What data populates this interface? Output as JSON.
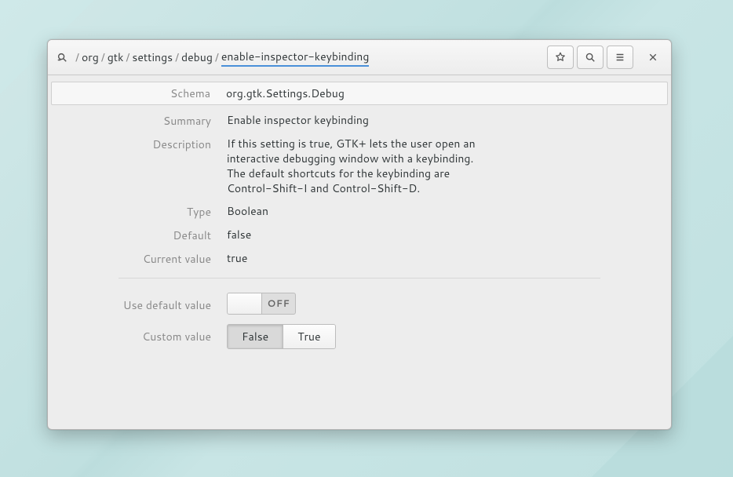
{
  "breadcrumb": {
    "segments": [
      "org",
      "gtk",
      "settings",
      "debug"
    ],
    "current": "enable-inspector-keybinding"
  },
  "labels": {
    "schema": "Schema",
    "summary": "Summary",
    "description": "Description",
    "type": "Type",
    "default": "Default",
    "current_value": "Current value",
    "use_default_value": "Use default value",
    "custom_value": "Custom value"
  },
  "values": {
    "schema": "org.gtk.Settings.Debug",
    "summary": "Enable inspector keybinding",
    "description": "If this setting is true, GTK+ lets the user open an interactive debugging window with a keybinding. The default shortcuts for the keybinding are Control-Shift-I and Control-Shift-D.",
    "type": "Boolean",
    "default": "false",
    "current_value": "true"
  },
  "switch": {
    "off_label": "OFF",
    "state": "off"
  },
  "custom_value_buttons": {
    "false_label": "False",
    "true_label": "True",
    "active": "false"
  }
}
